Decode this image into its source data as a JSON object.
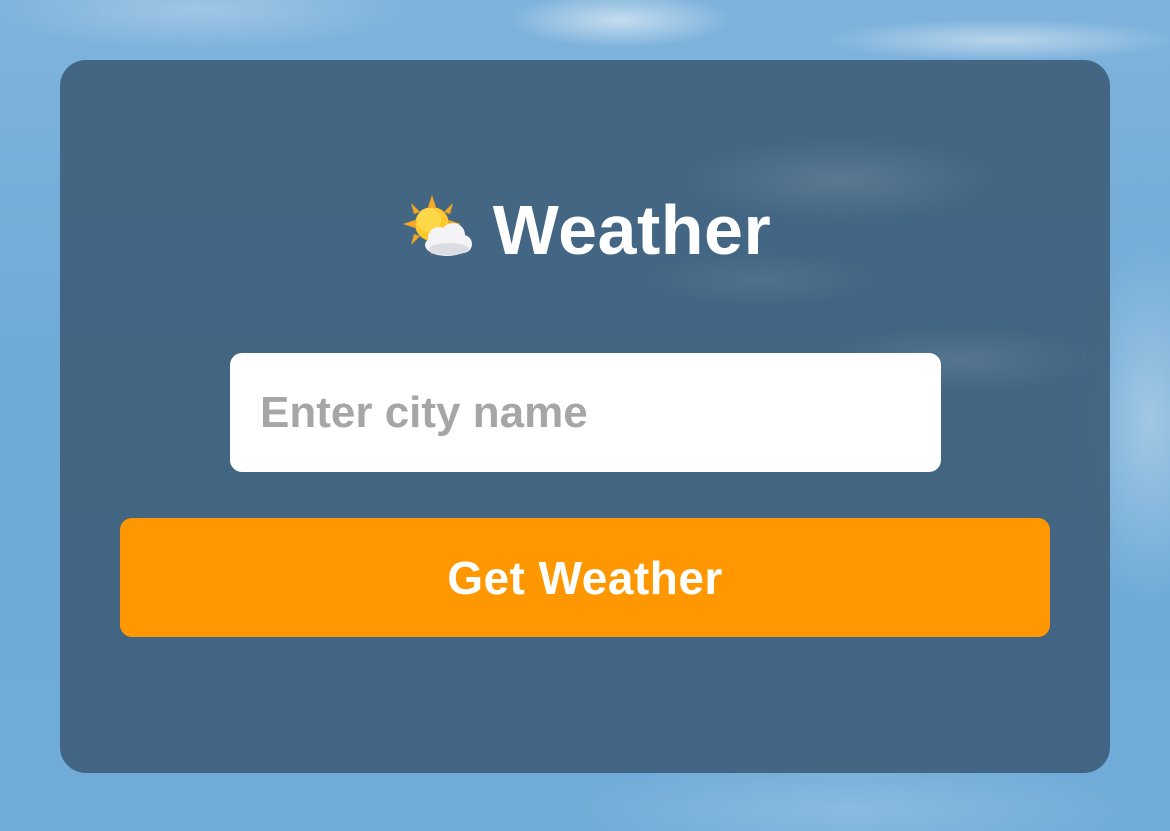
{
  "app": {
    "title": "Weather",
    "title_icon": "sun-behind-cloud-icon"
  },
  "search": {
    "placeholder": "Enter city name",
    "value": ""
  },
  "actions": {
    "get_weather_label": "Get Weather"
  },
  "colors": {
    "card_background": "#3a5a74",
    "button_accent": "#ff9800",
    "sky": "#71acd8",
    "placeholder_text": "#a6a6a6"
  }
}
